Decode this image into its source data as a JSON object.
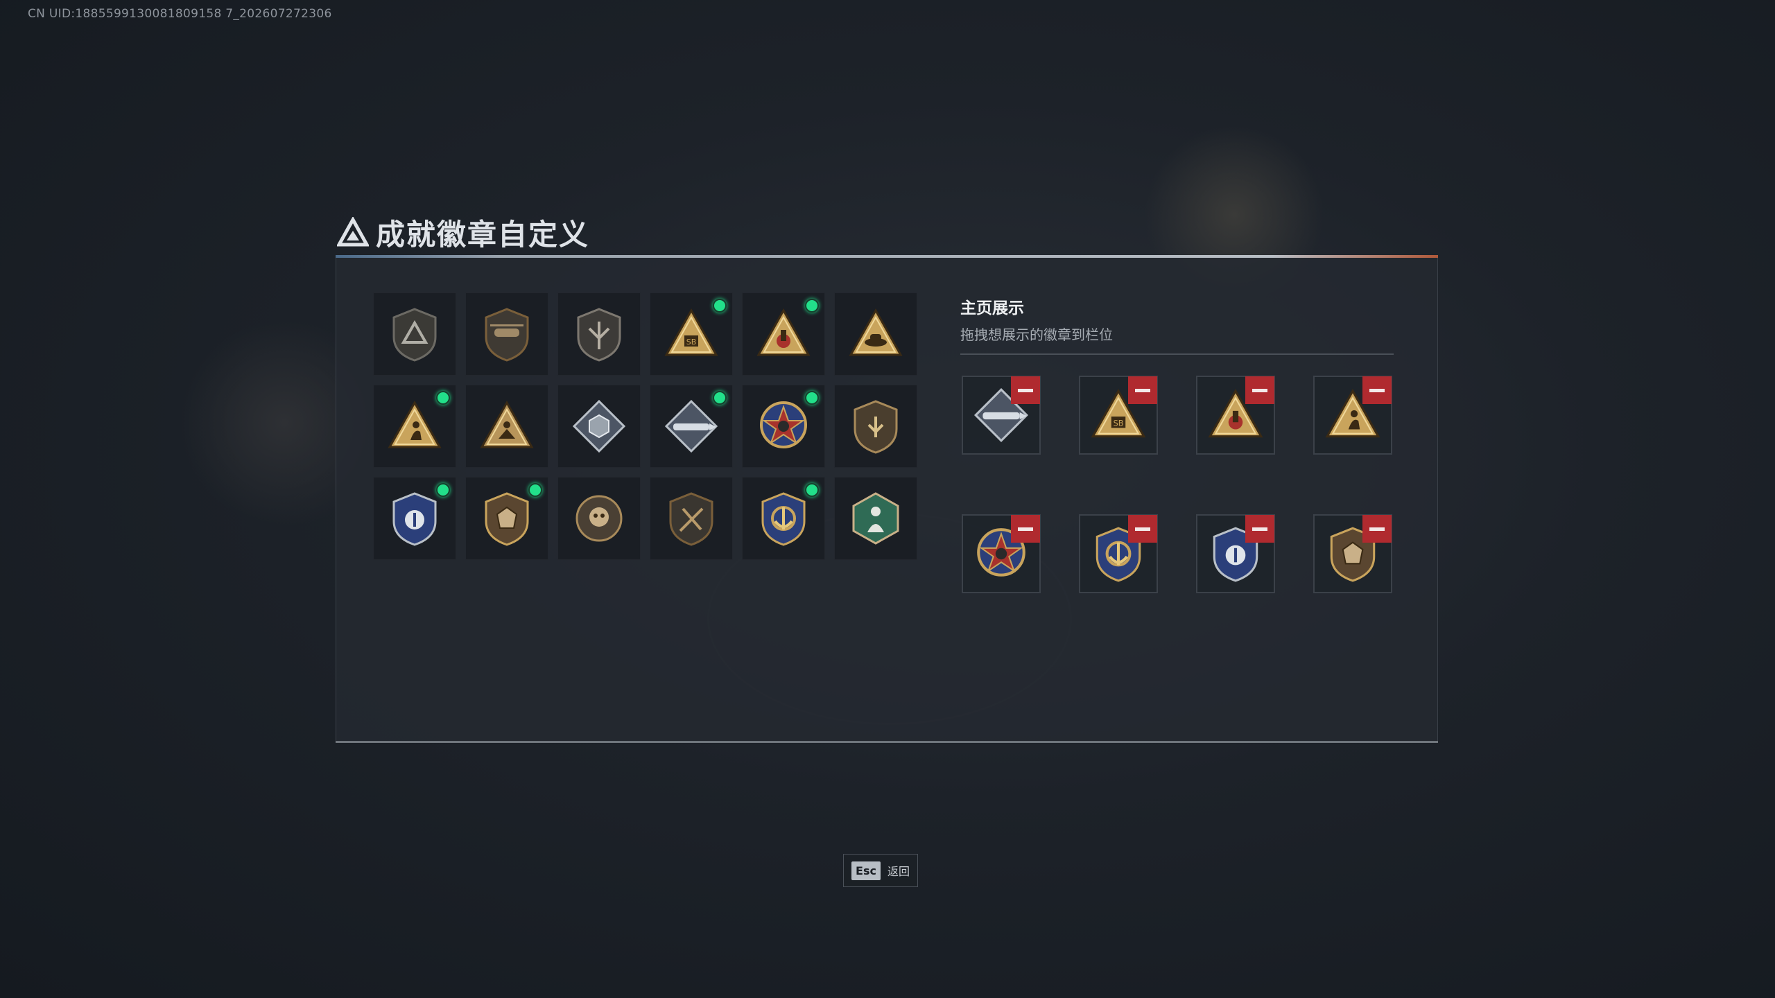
{
  "uid_text": "CN UID:1885599130081809158 7_202607272306",
  "page_title": "成就徽章自定义",
  "showcase": {
    "title": "主页展示",
    "subtitle": "拖拽想展示的徽章到栏位"
  },
  "badges": [
    {
      "icon": "shield-triangle-badge-icon",
      "new": false
    },
    {
      "icon": "helicopter-shield-badge-icon",
      "new": false
    },
    {
      "icon": "winged-shield-badge-icon",
      "new": false
    },
    {
      "icon": "sb-triangle-badge-icon",
      "new": true
    },
    {
      "icon": "hand-triangle-badge-icon",
      "new": true
    },
    {
      "icon": "hat-triangle-badge-icon",
      "new": false
    },
    {
      "icon": "crouching-figure-triangle-badge-icon",
      "new": true
    },
    {
      "icon": "winged-figure-triangle-badge-icon",
      "new": false
    },
    {
      "icon": "cube-diamond-badge-icon",
      "new": false
    },
    {
      "icon": "rocket-diamond-badge-icon",
      "new": true
    },
    {
      "icon": "red-star-medal-badge-icon",
      "new": true
    },
    {
      "icon": "bronze-shield-badge-icon",
      "new": false
    },
    {
      "icon": "blue-police-badge-icon",
      "new": true
    },
    {
      "icon": "bronze-crest-shield-badge-icon",
      "new": true
    },
    {
      "icon": "skull-round-badge-icon",
      "new": false
    },
    {
      "icon": "crossed-rifle-shield-badge-icon",
      "new": false
    },
    {
      "icon": "anchor-star-medal-badge-icon",
      "new": true
    },
    {
      "icon": "green-hexagon-figure-badge-icon",
      "new": false
    }
  ],
  "slots": [
    {
      "icon": "rocket-diamond-badge-icon"
    },
    {
      "icon": "sb-triangle-badge-icon"
    },
    {
      "icon": "hand-triangle-badge-icon"
    },
    {
      "icon": "crouching-figure-triangle-badge-icon"
    },
    {
      "icon": "red-star-medal-badge-icon"
    },
    {
      "icon": "anchor-star-medal-badge-icon"
    },
    {
      "icon": "blue-police-badge-icon"
    },
    {
      "icon": "bronze-crest-shield-badge-icon"
    }
  ],
  "back": {
    "key": "Esc",
    "label": "返回"
  },
  "colors": {
    "new_dot": "#22e08a",
    "remove_button": "#b02a2f",
    "gold": "#c9a45c",
    "bronze": "#7a5f3a",
    "silver": "#b9c0c8",
    "navy": "#2b3f7a",
    "red": "#a8322c",
    "green": "#2f6b55"
  }
}
